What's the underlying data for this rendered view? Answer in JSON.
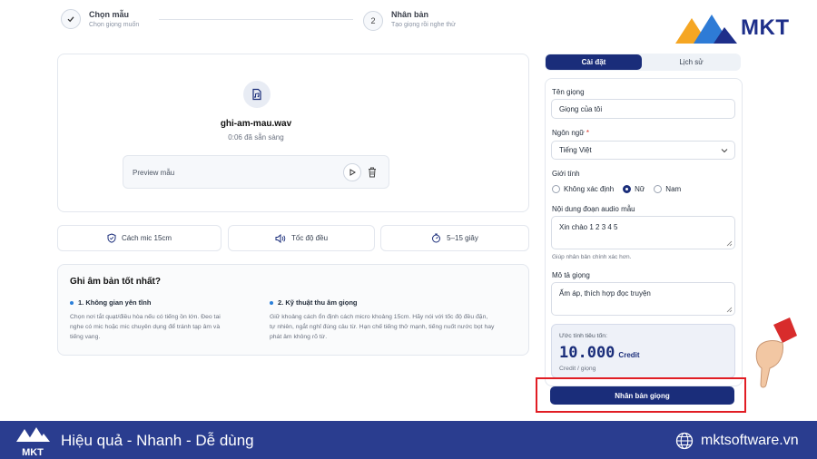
{
  "stepper": {
    "step1": {
      "icon": "check-icon",
      "title": "Chọn mẫu",
      "subtitle": "Chọn giọng muốn"
    },
    "step2": {
      "number": "2",
      "title": "Nhân bản",
      "subtitle": "Tạo giọng rồi nghe thử"
    }
  },
  "brand": {
    "logo_text": "MKT",
    "footer_logo_text": "MKT",
    "primary_color": "#1a2d7a",
    "accent_color": "#f5a623"
  },
  "upload": {
    "icon": "audio-file-icon",
    "file_name": "ghi-am-mau.wav",
    "status": "0:06 đã sẵn sàng",
    "preview_label": "Preview mẫu",
    "play_icon": "play-icon",
    "delete_icon": "trash-icon"
  },
  "chips": [
    {
      "icon": "shield-icon",
      "label": "Cách mic 15cm"
    },
    {
      "icon": "speaker-icon",
      "label": "Tốc độ đều"
    },
    {
      "icon": "timer-icon",
      "label": "5–15 giây"
    }
  ],
  "tips": {
    "title": "Ghi âm bản tốt nhất?",
    "items": [
      {
        "heading": "1. Không gian yên tĩnh",
        "lines": [
          "Chọn nơi tắt quạt/điều hòa nếu có tiếng ồn lớn. Đeo tai",
          "nghe có mic hoặc mic chuyên dụng để tránh tạp âm và",
          "tiếng vang."
        ]
      },
      {
        "heading": "2. Kỹ thuật thu âm giọng",
        "lines": [
          "Giữ khoảng cách ổn định cách micro khoảng 15cm. Hãy nói với tốc độ đều đặn,",
          "tự nhiên, ngắt nghỉ đúng câu từ. Hạn chế tiếng thở mạnh, tiếng nuốt nước bọt hay",
          "phát âm không rõ từ."
        ]
      }
    ]
  },
  "tabs": {
    "settings": "Cài đặt",
    "history": "Lịch sử"
  },
  "form": {
    "voice_name_label": "Tên giọng",
    "voice_name_value": "Giọng của tôi",
    "language_label": "Ngôn ngữ",
    "required_mark": "*",
    "language_value": "Tiếng Việt",
    "gender_label": "Giới tính",
    "gender_options": [
      "Không xác định",
      "Nữ",
      "Nam"
    ],
    "gender_selected": "Nữ",
    "sample_text_label": "Nội dung đoạn audio mẫu",
    "sample_text_value": "Xin chào 1 2 3 4 5",
    "sample_text_hint": "Giúp nhân bản chính xác hơn.",
    "description_label": "Mô tả giọng",
    "description_value": "Ấm áp, thích hợp đọc truyện"
  },
  "cost": {
    "label": "Ước tính tiêu tốn:",
    "value": "10.000",
    "unit": "Credit",
    "per": "Credit / giọng"
  },
  "submit_label": "Nhân bản giọng",
  "footer": {
    "slogan": "Hiệu quả - Nhanh - Dễ dùng",
    "url": "mktsoftware.vn",
    "globe_icon": "globe-icon"
  }
}
